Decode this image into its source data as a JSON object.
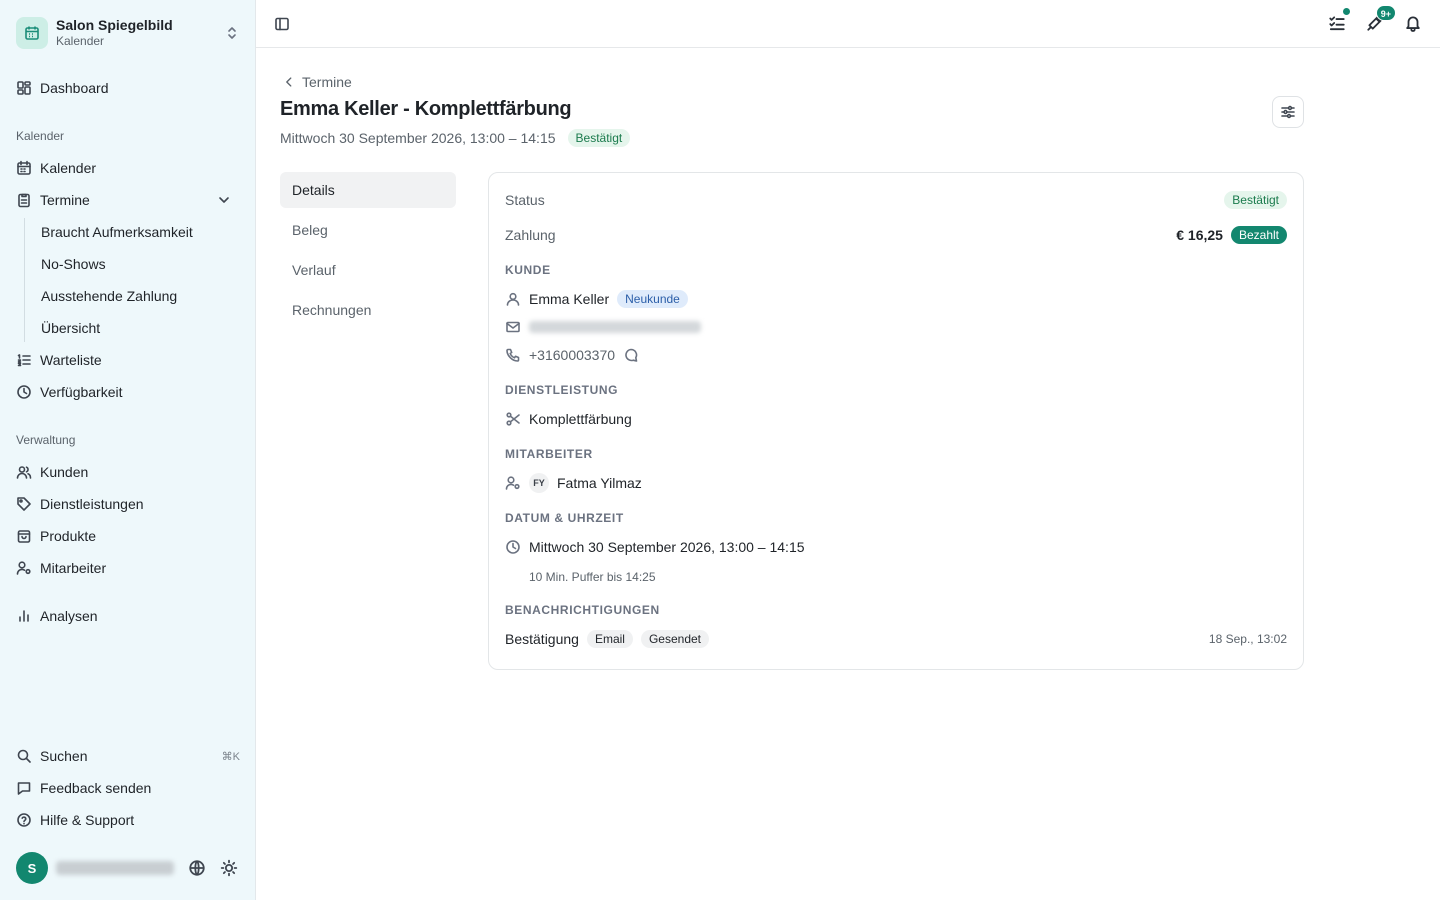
{
  "sidebar": {
    "brand_name": "Salon Spiegelbild",
    "brand_sub": "Kalender",
    "dashboard": "Dashboard",
    "group_kalender": "Kalender",
    "kalender": "Kalender",
    "termine": "Termine",
    "termine_sub": [
      "Braucht Aufmerksamkeit",
      "No-Shows",
      "Ausstehende Zahlung",
      "Übersicht"
    ],
    "warteliste": "Warteliste",
    "verfuegbarkeit": "Verfügbarkeit",
    "group_verwaltung": "Verwaltung",
    "kunden": "Kunden",
    "dienstleistungen": "Dienstleistungen",
    "produkte": "Produkte",
    "mitarbeiter": "Mitarbeiter",
    "analysen": "Analysen",
    "suchen": "Suchen",
    "suchen_shortcut": "⌘K",
    "feedback": "Feedback senden",
    "hilfe": "Hilfe & Support",
    "avatar_initial": "S"
  },
  "topbar": {
    "notification_count": "9+"
  },
  "header": {
    "back_label": "Termine",
    "title": "Emma Keller - Komplettfärbung",
    "datetime": "Mittwoch 30 September 2026, 13:00 – 14:15",
    "status_badge": "Bestätigt"
  },
  "tabs": [
    "Details",
    "Beleg",
    "Verlauf",
    "Rechnungen"
  ],
  "details": {
    "status_label": "Status",
    "status_value": "Bestätigt",
    "zahlung_label": "Zahlung",
    "amount": "€ 16,25",
    "payment_badge": "Bezahlt",
    "kunde_heading": "KUNDE",
    "customer_name": "Emma Keller",
    "customer_badge": "Neukunde",
    "phone": "+3160003370",
    "dienstleistung_heading": "DIENSTLEISTUNG",
    "service": "Komplettfärbung",
    "mitarbeiter_heading": "MITARBEITER",
    "staff_initials": "FY",
    "staff_name": "Fatma Yilmaz",
    "datum_heading": "DATUM & UHRZEIT",
    "datetime": "Mittwoch 30 September 2026, 13:00 – 14:15",
    "buffer": "10 Min. Puffer bis 14:25",
    "benachrichtigungen_heading": "BENACHRICHTIGUNGEN",
    "notif_label": "Bestätigung",
    "notif_channel": "Email",
    "notif_status": "Gesendet",
    "notif_time": "18 Sep., 13:02"
  }
}
